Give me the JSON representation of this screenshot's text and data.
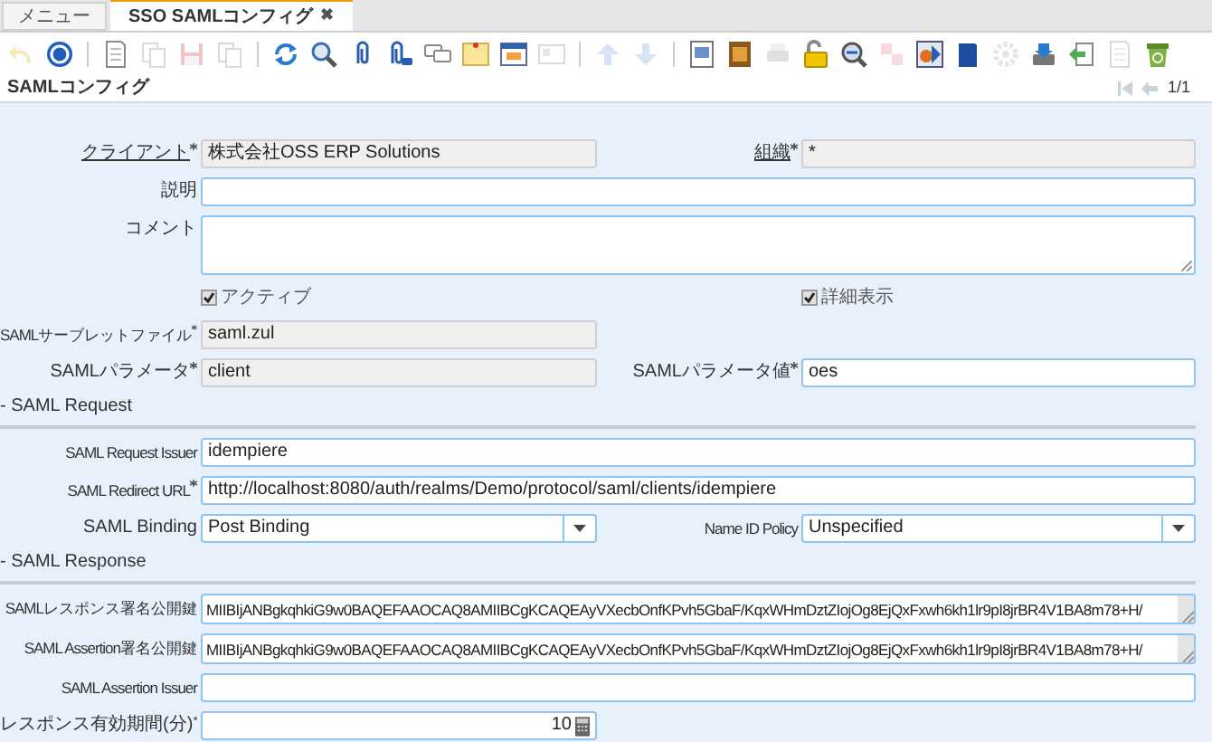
{
  "tabs": [
    {
      "label": "メニュー",
      "selected": false
    },
    {
      "label": "SSO SAMLコンフィグ",
      "selected": true,
      "close_glyph": "✖"
    }
  ],
  "toolbar": [
    {
      "kind": "undo",
      "disabled": true
    },
    {
      "kind": "help",
      "disabled": false
    },
    {
      "kind": "separator"
    },
    {
      "kind": "new",
      "disabled": false
    },
    {
      "kind": "copy",
      "disabled": true
    },
    {
      "kind": "save",
      "disabled": true
    },
    {
      "kind": "copy",
      "disabled": true
    },
    {
      "kind": "separator"
    },
    {
      "kind": "refresh",
      "disabled": false
    },
    {
      "kind": "search",
      "disabled": false
    },
    {
      "kind": "attachment",
      "disabled": false
    },
    {
      "kind": "attachment_link",
      "disabled": false
    },
    {
      "kind": "chat",
      "disabled": false
    },
    {
      "kind": "note",
      "disabled": false
    },
    {
      "kind": "grid",
      "disabled": false
    },
    {
      "kind": "card",
      "disabled": true
    },
    {
      "kind": "separator"
    },
    {
      "kind": "up",
      "disabled": true
    },
    {
      "kind": "down",
      "disabled": true
    },
    {
      "kind": "separator"
    },
    {
      "kind": "report",
      "disabled": false
    },
    {
      "kind": "archive",
      "disabled": false
    },
    {
      "kind": "print",
      "disabled": true
    },
    {
      "kind": "lock",
      "disabled": false
    },
    {
      "kind": "zoom_across",
      "disabled": false
    },
    {
      "kind": "request",
      "disabled": true
    },
    {
      "kind": "workflow",
      "disabled": false
    },
    {
      "kind": "book",
      "disabled": false
    },
    {
      "kind": "gear",
      "disabled": true
    },
    {
      "kind": "export",
      "disabled": false
    },
    {
      "kind": "import",
      "disabled": false
    },
    {
      "kind": "new",
      "disabled": true
    },
    {
      "kind": "recycle",
      "disabled": false
    }
  ],
  "header": {
    "title": "SAMLコンフィグ",
    "record": "1/1"
  },
  "rows": [
    {
      "kind": "pair",
      "left": {
        "label": "クライアント",
        "link": true,
        "required": true,
        "value": "株式会社OSS ERP Solutions",
        "readonly": true,
        "kind": "text"
      },
      "right": {
        "label": "組織",
        "link": true,
        "required": true,
        "value": "*",
        "readonly": true,
        "kind": "text"
      }
    },
    {
      "kind": "full",
      "field": {
        "label": "説明",
        "readonly": false,
        "kind": "text"
      }
    },
    {
      "kind": "full",
      "field": {
        "label": "コメント",
        "readonly": false,
        "kind": "textarea"
      }
    },
    {
      "kind": "checks",
      "left": {
        "label": "アクティブ",
        "checked": true
      },
      "right": {
        "label": "詳細表示",
        "checked": true
      }
    },
    {
      "kind": "pair",
      "left": {
        "label": "SAMLサーブレットファイル",
        "required": true,
        "value": "saml.zul",
        "readonly": true,
        "kind": "text"
      }
    },
    {
      "kind": "pair",
      "left": {
        "label": "SAMLパラメータ",
        "required": true,
        "value": "client",
        "readonly": true,
        "kind": "text"
      },
      "right": {
        "label": "SAMLパラメータ値",
        "required": true,
        "value": "oes",
        "readonly": false,
        "kind": "text"
      }
    },
    {
      "kind": "section",
      "label": "- SAML Request"
    },
    {
      "kind": "full",
      "field": {
        "label": "SAML Request Issuer",
        "value": "idempiere",
        "readonly": false,
        "kind": "text"
      }
    },
    {
      "kind": "full",
      "field": {
        "label": "SAML Redirect URL",
        "required": true,
        "value": "http://localhost:8080/auth/realms/Demo/protocol/saml/clients/idempiere",
        "readonly": false,
        "kind": "text"
      }
    },
    {
      "kind": "pair",
      "left": {
        "label": "SAML Binding",
        "value": "Post Binding",
        "readonly": false,
        "kind": "select"
      },
      "right": {
        "label": "Name ID Policy",
        "value": "Unspecified",
        "readonly": false,
        "kind": "select"
      }
    },
    {
      "kind": "section",
      "label": "- SAML Response"
    },
    {
      "kind": "full",
      "field": {
        "label": "SAMLレスポンス署名公開鍵",
        "value": "MIIBIjANBgkqhkiG9w0BAQEFAAOCAQ8AMIIBCgKCAQEAyVXecbOnfKPvh5GbaF/KqxWHmDztZIojOg8EjQxFxwh6kh1lr9pI8jrBR4V1BA8m78+H/",
        "readonly": false,
        "kind": "keytext"
      }
    },
    {
      "kind": "full",
      "field": {
        "label": "SAML Assertion署名公開鍵",
        "value": "MIIBIjANBgkqhkiG9w0BAQEFAAOCAQ8AMIIBCgKCAQEAyVXecbOnfKPvh5GbaF/KqxWHmDztZIojOg8EjQxFxwh6kh1lr9pI8jrBR4V1BA8m78+H/",
        "readonly": false,
        "kind": "keytext"
      }
    },
    {
      "kind": "full",
      "field": {
        "label": "SAML Assertion Issuer",
        "readonly": false,
        "kind": "text"
      }
    },
    {
      "kind": "pair",
      "left": {
        "label": "レスポンス有効期間(分)",
        "required": true,
        "value": "10",
        "readonly": false,
        "kind": "number"
      }
    }
  ]
}
